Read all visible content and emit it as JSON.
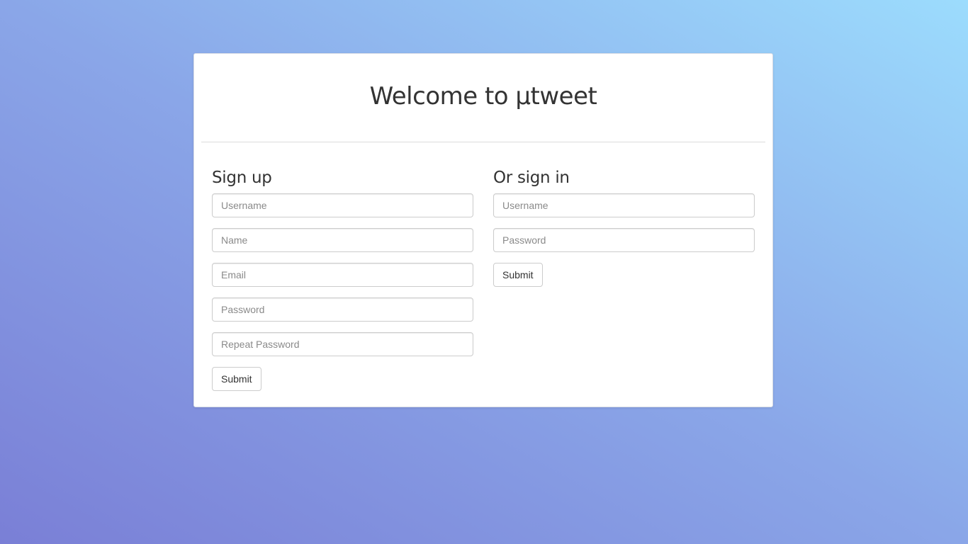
{
  "card": {
    "title": "Welcome to µtweet"
  },
  "signup": {
    "heading": "Sign up",
    "fields": {
      "username_placeholder": "Username",
      "name_placeholder": "Name",
      "email_placeholder": "Email",
      "password_placeholder": "Password",
      "repeat_password_placeholder": "Repeat Password"
    },
    "submit_label": "Submit"
  },
  "signin": {
    "heading": "Or sign in",
    "fields": {
      "username_placeholder": "Username",
      "password_placeholder": "Password"
    },
    "submit_label": "Submit"
  },
  "colors": {
    "gradient_start": "#7a7fd6",
    "gradient_end": "#9cdcfd",
    "card_background": "#ffffff",
    "text": "#333333"
  }
}
